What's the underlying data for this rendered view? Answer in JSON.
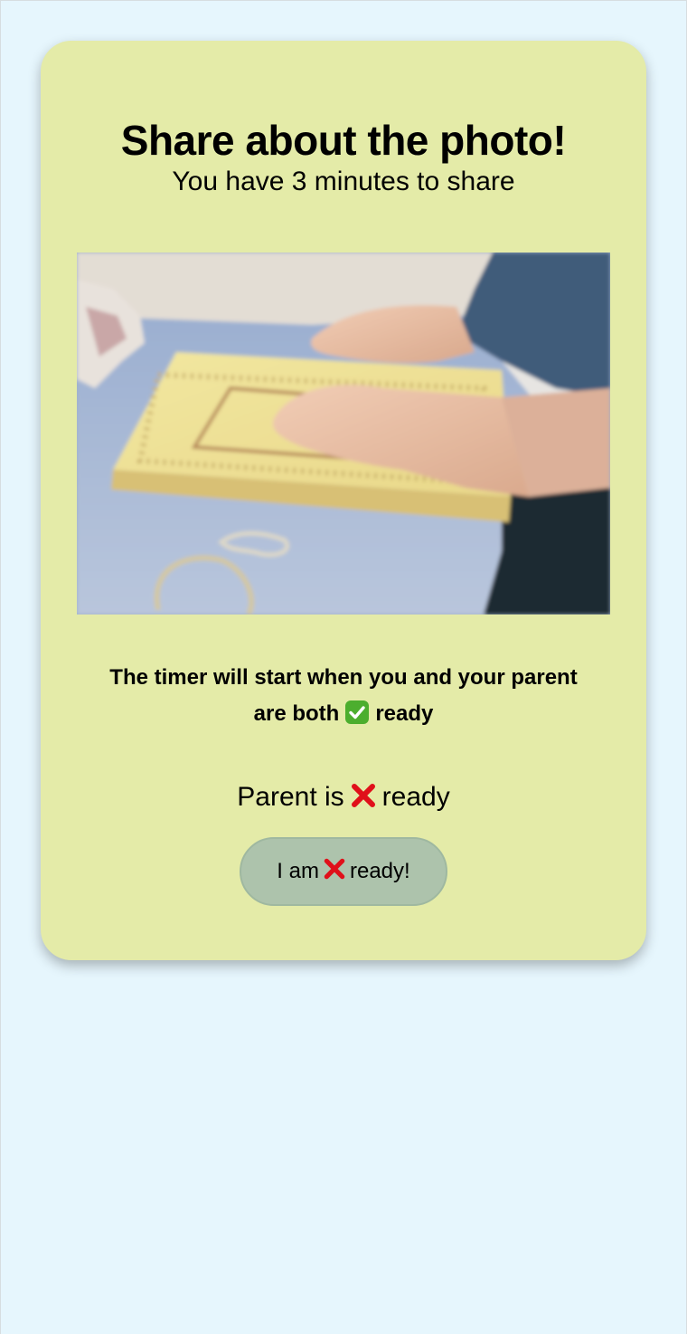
{
  "card": {
    "title": "Share about the photo!",
    "subtitle": "You have 3 minutes to share",
    "timer_note": {
      "before": "The timer will start when you and your parent are both",
      "after": "ready"
    },
    "parent_status": {
      "before": "Parent is",
      "after": "ready"
    },
    "ready_button": {
      "before": "I am",
      "after": "ready!"
    }
  },
  "icons": {
    "ready_check": "check-mark-icon",
    "not_ready": "cross-mark-icon"
  },
  "colors": {
    "page_background": "#e6f6fd",
    "card_background": "#e4eba8",
    "button_background": "#adc3ac",
    "check_green": "#4cae2e",
    "cross_red": "#e0101a"
  }
}
